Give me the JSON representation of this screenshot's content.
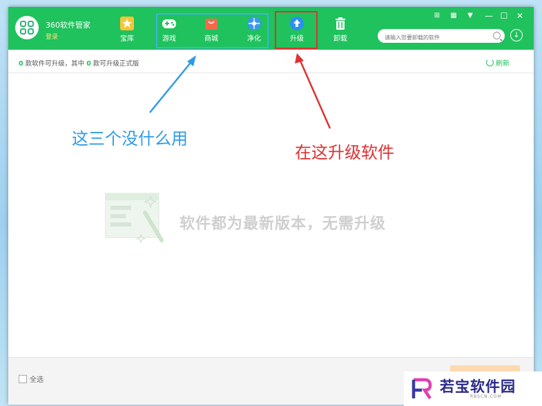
{
  "app": {
    "title": "360软件管家",
    "login": "登录"
  },
  "nav": [
    {
      "id": "store",
      "label": "宝库"
    },
    {
      "id": "games",
      "label": "游戏"
    },
    {
      "id": "mall",
      "label": "商城"
    },
    {
      "id": "clean",
      "label": "净化"
    },
    {
      "id": "upgrade",
      "label": "升级"
    },
    {
      "id": "uninstall",
      "label": "卸载"
    }
  ],
  "window_controls": {
    "minimize": "—",
    "maximize": "☐",
    "close": "✕"
  },
  "search": {
    "placeholder": "请输入您要卸载的软件"
  },
  "status": {
    "count_a": "0",
    "text_a": "款软件可升级，其中",
    "count_b": "0",
    "text_b": "款可升级正式版"
  },
  "refresh_label": "刷新",
  "annotations": {
    "blue": "这三个没什么用",
    "red": "在这升级软件"
  },
  "empty_message": "软件都为最新版本，无需升级",
  "footer": {
    "select_all": "全选"
  },
  "watermark": {
    "text": "若宝软件园",
    "sub": "RBSCN.COM"
  },
  "colors": {
    "brand_green": "#1fc25c",
    "annotation_blue": "#2e9be6",
    "annotation_red": "#e03030"
  }
}
